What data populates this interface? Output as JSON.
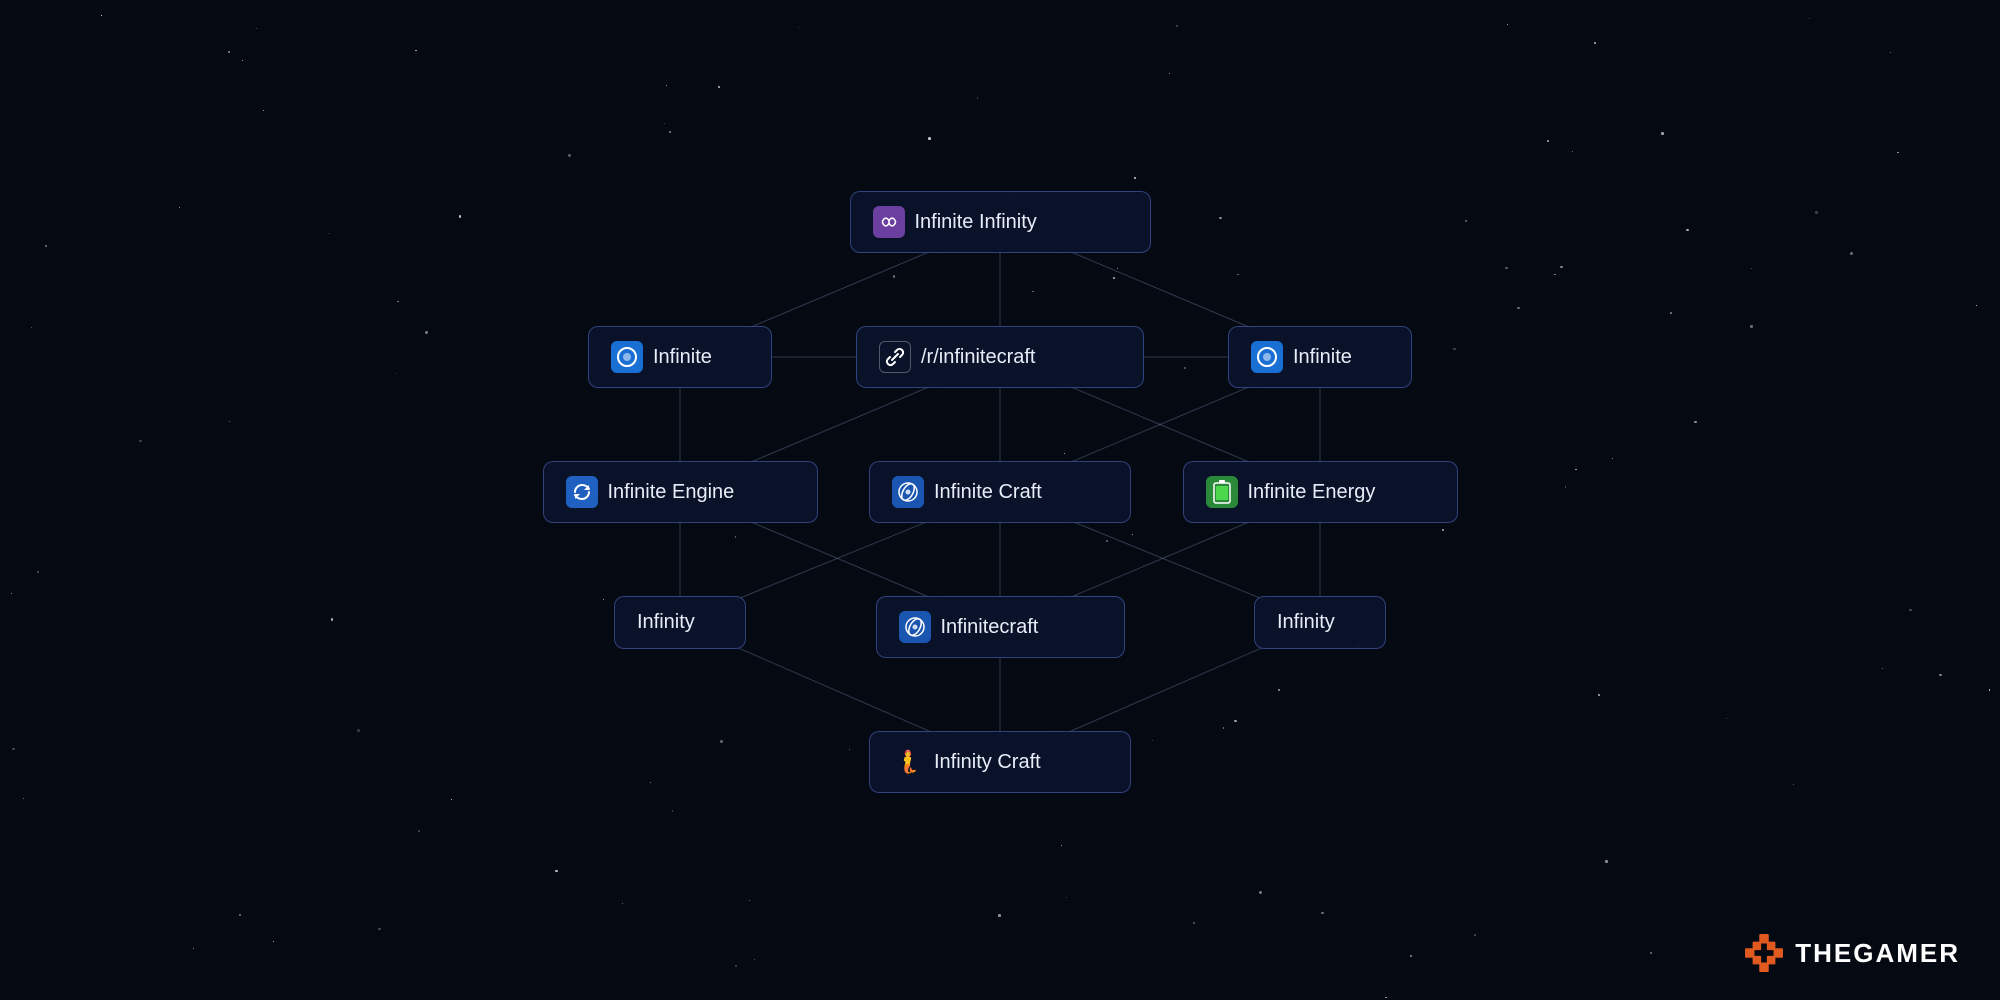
{
  "background": "#050a12",
  "watermark": {
    "text": "THEGAMER",
    "icon_color": "#e05a20"
  },
  "nodes": [
    {
      "id": "infinite-infinity",
      "label": "Infinite Infinity",
      "icon": "∞",
      "icon_class": "icon-purple",
      "col": 1,
      "row": 0
    },
    {
      "id": "infinite-left",
      "label": "Infinite",
      "icon": "🔵",
      "icon_class": "icon-blue",
      "col": 0,
      "row": 1
    },
    {
      "id": "r-infinitecraft",
      "label": "/r/infinitecraft",
      "icon": "🔗",
      "icon_class": "icon-transparent",
      "col": 1,
      "row": 1
    },
    {
      "id": "infinite-right",
      "label": "Infinite",
      "icon": "🔵",
      "icon_class": "icon-blue",
      "col": 2,
      "row": 1
    },
    {
      "id": "infinite-engine",
      "label": "Infinite Engine",
      "icon": "🔄",
      "icon_class": "icon-blue",
      "col": 0,
      "row": 2
    },
    {
      "id": "infinite-craft",
      "label": "Infinite Craft",
      "icon": "🌀",
      "icon_class": "icon-blue",
      "col": 1,
      "row": 2
    },
    {
      "id": "infinite-energy",
      "label": "Infinite Energy",
      "icon": "🔋",
      "icon_class": "icon-green",
      "col": 2,
      "row": 2
    },
    {
      "id": "infinity-left",
      "label": "Infinity",
      "icon": null,
      "icon_class": null,
      "col": 0,
      "row": 3
    },
    {
      "id": "infinitecraft",
      "label": "Infinitecraft",
      "icon": "🌌",
      "icon_class": "icon-blue",
      "col": 1,
      "row": 3
    },
    {
      "id": "infinity-right",
      "label": "Infinity",
      "icon": null,
      "icon_class": null,
      "col": 2,
      "row": 3
    },
    {
      "id": "infinity-craft",
      "label": "Infinity Craft",
      "icon": "🧜",
      "icon_class": "icon-transparent",
      "col": 1,
      "row": 4
    }
  ],
  "connections": [
    [
      "infinite-infinity",
      "infinite-left"
    ],
    [
      "infinite-infinity",
      "r-infinitecraft"
    ],
    [
      "infinite-infinity",
      "infinite-right"
    ],
    [
      "infinite-left",
      "infinite-engine"
    ],
    [
      "infinite-left",
      "r-infinitecraft"
    ],
    [
      "r-infinitecraft",
      "infinite-engine"
    ],
    [
      "r-infinitecraft",
      "infinite-craft"
    ],
    [
      "r-infinitecraft",
      "infinite-energy"
    ],
    [
      "infinite-right",
      "r-infinitecraft"
    ],
    [
      "infinite-right",
      "infinite-craft"
    ],
    [
      "infinite-right",
      "infinite-energy"
    ],
    [
      "infinite-engine",
      "infinity-left"
    ],
    [
      "infinite-engine",
      "infinitecraft"
    ],
    [
      "infinite-craft",
      "infinity-left"
    ],
    [
      "infinite-craft",
      "infinitecraft"
    ],
    [
      "infinite-craft",
      "infinity-right"
    ],
    [
      "infinite-energy",
      "infinitecraft"
    ],
    [
      "infinite-energy",
      "infinity-right"
    ],
    [
      "infinity-left",
      "infinity-craft"
    ],
    [
      "infinitecraft",
      "infinity-craft"
    ],
    [
      "infinity-right",
      "infinity-craft"
    ]
  ]
}
